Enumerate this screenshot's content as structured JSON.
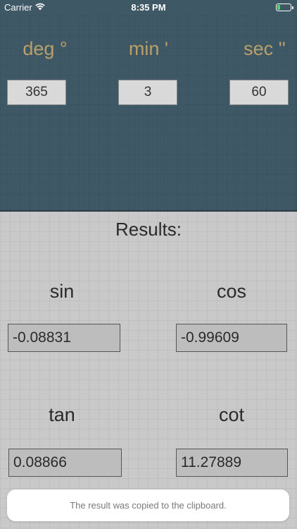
{
  "status_bar": {
    "carrier": "Carrier",
    "time": "8:35 PM",
    "wifi_icon": "wifi-icon",
    "battery_icon": "battery-icon",
    "battery_level": 0.2
  },
  "inputs": {
    "deg": {
      "label": "deg °",
      "value": "365"
    },
    "min": {
      "label": "min '",
      "value": "3"
    },
    "sec": {
      "label": "sec ''",
      "value": "60"
    }
  },
  "results": {
    "title": "Results:",
    "sin": {
      "label": "sin",
      "value": "-0.08831"
    },
    "cos": {
      "label": "cos",
      "value": "-0.99609"
    },
    "tan": {
      "label": "tan",
      "value": "0.08866"
    },
    "cot": {
      "label": "cot",
      "value": "11.27889"
    }
  },
  "toast": {
    "message": "The result was copied to the clipboard."
  },
  "colors": {
    "top_background": "#3f5866",
    "label_gold": "#b9a06a",
    "results_background": "#c9c9c9"
  }
}
